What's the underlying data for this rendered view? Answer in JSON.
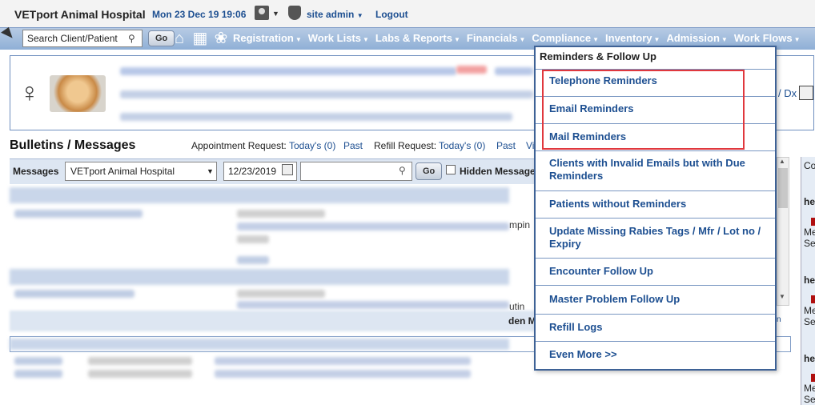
{
  "topbar": {
    "hospital_name": "VETport Animal Hospital",
    "datetime": "Mon 23 Dec 19 19:06",
    "user_menu": "site admin",
    "logout": "Logout"
  },
  "nav": {
    "search_placeholder": "Search Client/Patient",
    "go_label": "Go",
    "menu_items": [
      "Registration",
      "Work Lists",
      "Labs & Reports",
      "Financials",
      "Compliance",
      "Inventory",
      "Admission",
      "Work Flows"
    ]
  },
  "patient": {
    "dx_text": "/ Dx"
  },
  "bulletins": {
    "title": "Bulletins / Messages",
    "appt_label": "Appointment Request:",
    "appt_today": "Today's (0)",
    "appt_past": "Past",
    "refill_label": "Refill Request:",
    "refill_today": "Today's (0)",
    "refill_past": "Past",
    "vi": "Vi",
    "messages_label": "Messages",
    "hospital_select": "VETport Animal Hospital",
    "date_value": "12/23/2019",
    "search_value": "",
    "go_label": "Go",
    "hidden_messages_label": "Hidden Message",
    "mid_text_1": "mpin",
    "mid_text_2": "utin",
    "second_hidden": "den Me",
    "tin": "tin"
  },
  "right_col": {
    "header": "Co",
    "he_1": "he",
    "me_1": "Me",
    "se_1": "Se",
    "he_2": "he",
    "me_2": "Me",
    "se_2": "Se",
    "he_3": "he",
    "me_3": "Me",
    "se_3": "Se"
  },
  "dropdown": {
    "title": "Reminders & Follow Up",
    "items": [
      "Telephone Reminders",
      "Email Reminders",
      "Mail Reminders",
      "Clients with Invalid Emails but with Due Reminders",
      "Patients without Reminders",
      "Update Missing Rabies Tags / Mfr / Lot no / Expiry",
      "Encounter Follow Up",
      "Master Problem Follow Up",
      "Refill Logs",
      "Even More >>"
    ]
  },
  "colors": {
    "link_blue": "#1d4f91",
    "nav_gradient_top": "#b7cbe4",
    "nav_gradient_bottom": "#8fafd6",
    "highlight_red": "#e0383e"
  }
}
